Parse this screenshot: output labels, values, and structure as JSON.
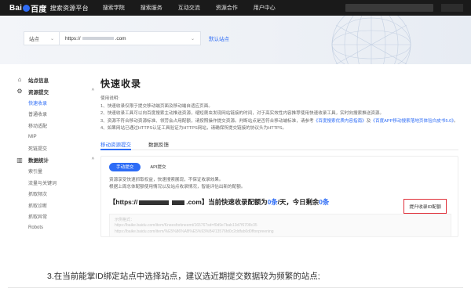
{
  "topbar": {
    "logo_prefix": "Bai",
    "logo_suffix": "百度",
    "platform": "搜索资源平台",
    "nav": [
      "搜索学院",
      "搜索服务",
      "互动交流",
      "资源合作",
      "用户中心"
    ]
  },
  "site_selector": {
    "label": "站点",
    "url_prefix": "https://",
    "url_suffix": ".com",
    "default_site": "默认站点"
  },
  "sidebar": {
    "groups": [
      {
        "icon": "home-icon",
        "label": "站点信息",
        "items": []
      },
      {
        "icon": "settings-icon",
        "label": "资源提交",
        "expanded": true,
        "items": [
          "快速收录",
          "普通收录",
          "移动适配",
          "MIP",
          "死链提交"
        ]
      },
      {
        "icon": "chart-icon",
        "label": "数据统计",
        "expanded": true,
        "items": [
          "索引量",
          "流量与关键词",
          "抓取频次",
          "抓取诊断",
          "抓取异常",
          "Robots"
        ]
      }
    ],
    "active_item": "快速收录"
  },
  "main": {
    "title": "快速收录",
    "usage_title": "使用说明:",
    "usage_lines": [
      "1、快速收录仅限于提交移动端页面及移动端自适应页面。",
      "2、快速收录工具可以向百度搜索主动推送资源，缩短爬虫发现网站链接的时间，对于高实效性内容推荐使用快速收录工具，实时向搜索推送资源。",
      "3、资源不符合移动资源标准、领劳会占用配额，请按照操作提交资源。判断站点是否符合移动端标准，请参考",
      "4、如果网站已通过HTTPS认证工具验证为HTTPS网站，请确保所提交链接的协议头为HTTPS。"
    ],
    "usage_link_1": "《百度搜索优质内容指南》",
    "usage_link_mid": "及",
    "usage_link_2": "《百度APP移动搜索落地页体验白皮书5.0》",
    "usage_link_end": "。",
    "tabs": [
      "移动资源提交",
      "数据反馈"
    ],
    "subtabs": [
      "手动提交",
      "API提交"
    ],
    "desc_lines": [
      "资源享受快速抓取权益，快速搜索展现，不保证收录效果。",
      "根据上周总体配额使用情况以及站点收录情况，智能评估出新的配额。"
    ],
    "quota": {
      "prefix": "【https://",
      "suffix": ".com】当前快速收录配额为",
      "quota_value": "0条",
      "mid": "/天，今日剩余",
      "remaining": "0条"
    },
    "quota_button": "提升收录ID配额",
    "code_lines": [
      "示例格式：",
      "https://baike.baidu.com/item/Kneesforkneemt/16576?sd=f0d9e7bab13d7f6708c35",
      "https://baike.baidu.com/item/%E5%86%AB%E5%93%B4/13576fd0c2ddfab0d0ffonpreening"
    ]
  },
  "caption": "3.在当前能掌ID绑定站点中选择站点，建议选近期提交数据较为频繁的站点;"
}
